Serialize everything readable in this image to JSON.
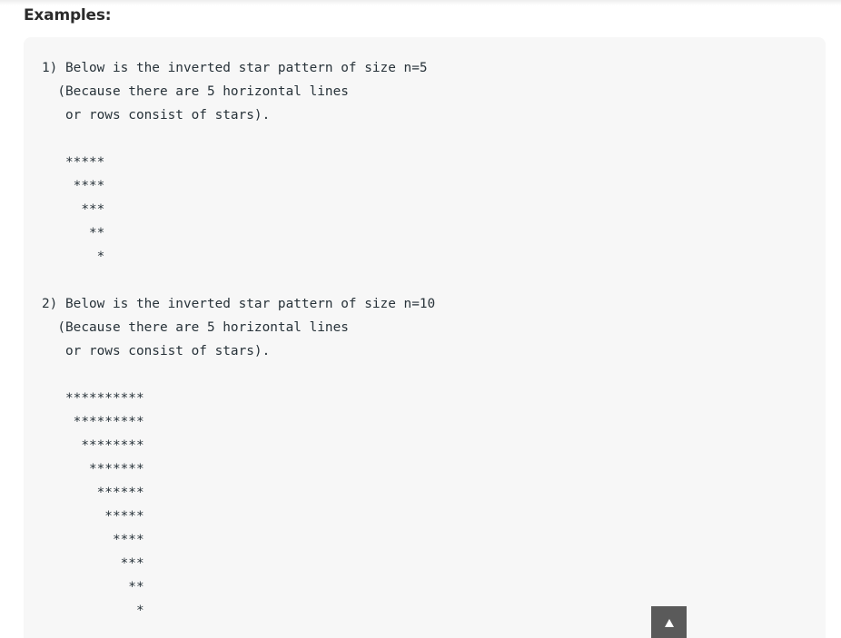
{
  "heading": "Examples:",
  "code_lines": [
    "1) Below is the inverted star pattern of size n=5",
    "  (Because there are 5 horizontal lines",
    "   or rows consist of stars).",
    "",
    "   *****",
    "    ****",
    "     ***",
    "      **",
    "       *",
    "",
    "2) Below is the inverted star pattern of size n=10",
    "  (Because there are 5 horizontal lines",
    "   or rows consist of stars).",
    "",
    "   **********",
    "    *********",
    "     ********",
    "      *******",
    "       ******",
    "        *****",
    "         ****",
    "          ***",
    "           **",
    "            *"
  ],
  "scroll_top": {
    "icon": "arrow-up-icon",
    "glyph": "▲",
    "background": "#5a5a5a"
  },
  "colors": {
    "code_background": "#f7f7f7",
    "code_text": "#273239",
    "heading_text": "#2b2b2b"
  }
}
